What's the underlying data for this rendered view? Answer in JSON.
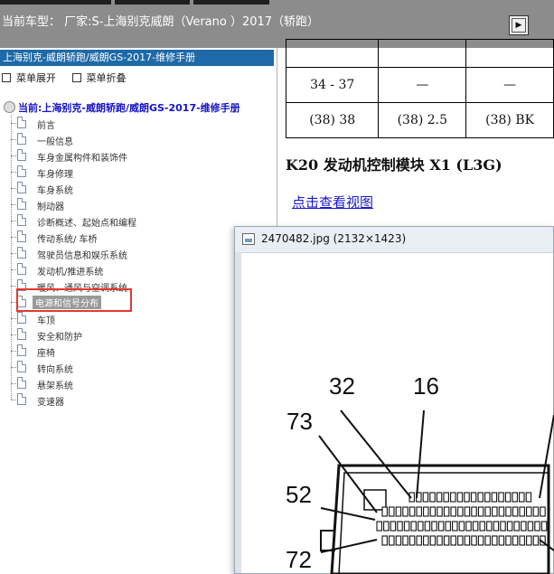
{
  "header": {
    "current_model_label": "当前车型：  厂家:S-上海别克威朗（Verano ）2017（轿跑）"
  },
  "sidebar": {
    "title": "上海别克-威朗轿跑/威朗GS-2017-维修手册",
    "menu_expand": "菜单展开",
    "menu_collapse": "菜单折叠",
    "root_label": "当前:上海别克-威朗轿跑/威朗GS-2017-维修手册",
    "items": [
      {
        "label": "前言"
      },
      {
        "label": "一般信息"
      },
      {
        "label": "车身金属构件和装饰件"
      },
      {
        "label": "车身修理"
      },
      {
        "label": "车身系统"
      },
      {
        "label": "制动器"
      },
      {
        "label": "诊断概述、起始点和编程"
      },
      {
        "label": "传动系统/ 车桥"
      },
      {
        "label": "驾驶员信息和娱乐系统"
      },
      {
        "label": "发动机/推进系统"
      },
      {
        "label": "暖风、通风与空调系统"
      },
      {
        "label": "电源和信号分布"
      },
      {
        "label": "车顶"
      },
      {
        "label": "安全和防护"
      },
      {
        "label": "座椅"
      },
      {
        "label": "转向系统"
      },
      {
        "label": "悬架系统"
      },
      {
        "label": "变速器"
      }
    ]
  },
  "content": {
    "table_rows": [
      [
        "",
        "",
        ""
      ],
      [
        "34 - 37",
        "—",
        "—"
      ],
      [
        "(38) 38",
        "(38) 2.5",
        "(38) BK"
      ]
    ],
    "heading": "K20 发动机控制模块 X1 (L3G)",
    "view_link": "点击查看视图"
  },
  "image_window": {
    "title": "2470482.jpg (2132×1423)",
    "pin_labels": [
      "32",
      "16",
      "73",
      "52",
      "72"
    ]
  },
  "colors": {
    "topbar": "#8c8c8c",
    "sidebar_title": "#1e6aa8",
    "root_text": "#1313c8",
    "highlight": "#e03a2e",
    "link": "#1818d0"
  }
}
